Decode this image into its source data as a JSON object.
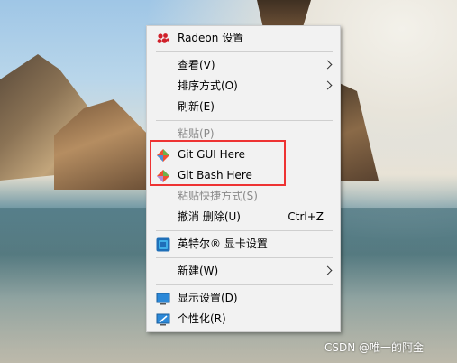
{
  "menu": {
    "items": [
      {
        "label": "Radeon 设置",
        "icon": "radeon-icon"
      },
      {
        "label": "查看(V)",
        "submenu": true
      },
      {
        "label": "排序方式(O)",
        "submenu": true
      },
      {
        "label": "刷新(E)"
      },
      {
        "label": "粘贴(P)",
        "disabled": true
      },
      {
        "label": "Git GUI Here",
        "icon": "git-icon"
      },
      {
        "label": "Git Bash Here",
        "icon": "git-icon"
      },
      {
        "label": "粘贴快捷方式(S)",
        "disabled": true
      },
      {
        "label": "撤消 删除(U)",
        "shortcut": "Ctrl+Z"
      },
      {
        "label": "英特尔® 显卡设置",
        "icon": "intel-graphics-icon"
      },
      {
        "label": "新建(W)",
        "submenu": true
      },
      {
        "label": "显示设置(D)",
        "icon": "display-icon"
      },
      {
        "label": "个性化(R)",
        "icon": "personalize-icon"
      }
    ]
  },
  "watermark": "CSDN @唯一的阿金",
  "colors": {
    "highlight": "#e33333",
    "menu_bg": "#f2f2f2"
  }
}
